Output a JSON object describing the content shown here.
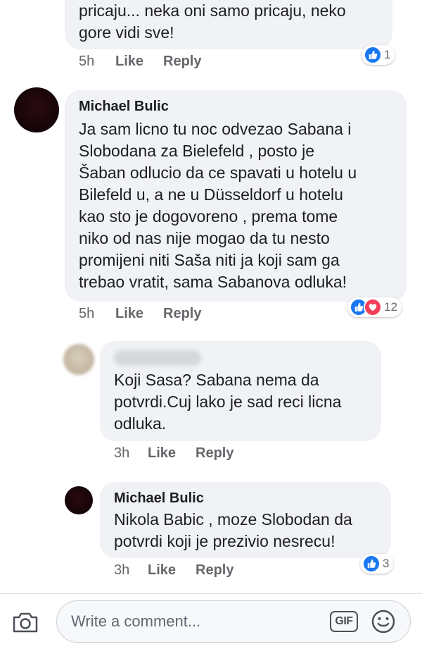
{
  "comments": [
    {
      "id": "top-partial",
      "author": "",
      "lines": [
        "pricaju... neka oni samo pricaju, neko",
        "gore vidi sve!"
      ],
      "time": "5h",
      "like_label": "Like",
      "reply_label": "Reply",
      "reactions": {
        "icons": [
          "like-icon"
        ],
        "count": "1"
      }
    },
    {
      "id": "michael-1",
      "author": "Michael Bulic",
      "lines": [
        "Ja sam licno tu noc odvezao Sabana i",
        "Slobodana za Bielefeld , posto je",
        "Šaban odlucio da ce spavati u hotelu u",
        "Bilefeld u, a ne u Düsseldorf u hotelu",
        "kao sto je dogovoreno , prema tome",
        "niko od nas nije mogao da tu nesto",
        "promijeni niti Saša niti ja koji sam ga",
        "trebao vratit, sama Sabanova odluka!"
      ],
      "time": "5h",
      "like_label": "Like",
      "reply_label": "Reply",
      "reactions": {
        "icons": [
          "like-icon",
          "love-icon"
        ],
        "count": "12"
      }
    },
    {
      "id": "reply-1",
      "author": "",
      "lines": [
        "Koji Sasa? Sabana nema da",
        "potvrdi.Cuj lako je sad reci licna",
        "odluka."
      ],
      "time": "3h",
      "like_label": "Like",
      "reply_label": "Reply"
    },
    {
      "id": "reply-2",
      "author": "Michael Bulic",
      "lines": [
        "Nikola Babic , moze Slobodan da",
        "potvrdi koji je prezivio nesrecu!"
      ],
      "time": "3h",
      "like_label": "Like",
      "reply_label": "Reply",
      "reactions": {
        "icons": [
          "like-icon"
        ],
        "count": "3"
      }
    }
  ],
  "composer": {
    "placeholder": "Write a comment...",
    "gif_label": "GIF",
    "icons": [
      "camera-icon",
      "gif-icon",
      "smiley-icon"
    ]
  },
  "colors": {
    "bubble": "#f0f2f5",
    "like_blue": "#1877f2",
    "love_red": "#f33e58",
    "avatar_dark": "#1a0508"
  }
}
